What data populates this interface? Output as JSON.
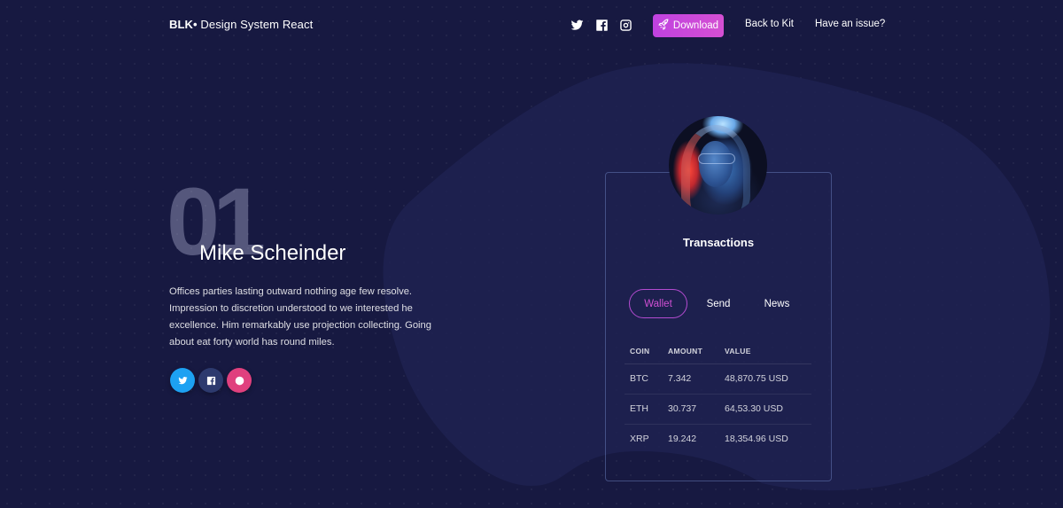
{
  "navbar": {
    "brand_bold": "BLK•",
    "brand_rest": " Design System React",
    "social_icons": [
      "twitter-icon",
      "facebook-icon",
      "instagram-icon"
    ],
    "download_label": "Download",
    "download_icon": "rocket-icon",
    "links": [
      "Back to Kit",
      "Have an issue?"
    ]
  },
  "profile": {
    "number": "01",
    "name": "Mike Scheinder",
    "bio": "Offices parties lasting outward nothing age few resolve. Impression to discretion understood to we interested he excellence. Him remarkably use projection collecting. Going about eat forty world has round miles.",
    "social": [
      {
        "icon": "twitter-icon",
        "color": "#1da1f2"
      },
      {
        "icon": "facebook-icon",
        "color": "#2d3a6e"
      },
      {
        "icon": "dribbble-icon",
        "color": "#ea4c89"
      }
    ]
  },
  "card": {
    "avatar_alt": "profile photo",
    "title": "Transactions",
    "tabs": [
      {
        "label": "Wallet",
        "active": true
      },
      {
        "label": "Send",
        "active": false
      },
      {
        "label": "News",
        "active": false
      }
    ],
    "table": {
      "headers": [
        "COIN",
        "AMOUNT",
        "VALUE"
      ],
      "rows": [
        [
          "BTC",
          "7.342",
          "48,870.75 USD"
        ],
        [
          "ETH",
          "30.737",
          "64,53.30 USD"
        ],
        [
          "XRP",
          "19.242",
          "18,354.96 USD"
        ]
      ]
    }
  },
  "colors": {
    "background": "#171941",
    "accent": "#d04fd4",
    "download_gradient": [
      "#c042e0",
      "#d44fd2"
    ]
  }
}
